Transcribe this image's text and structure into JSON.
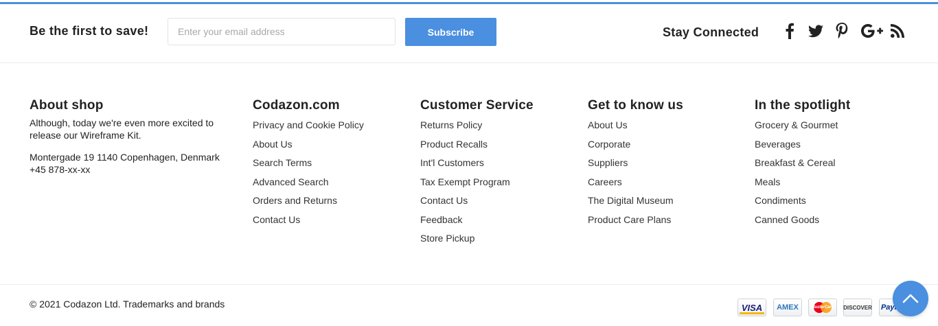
{
  "newsletter": {
    "title": "Be the first to save!",
    "email_placeholder": "Enter your email address",
    "email_value": "",
    "subscribe_label": "Subscribe"
  },
  "social": {
    "title": "Stay Connected",
    "icons": [
      "facebook-icon",
      "twitter-icon",
      "pinterest-icon",
      "google-plus-icon",
      "rss-icon"
    ]
  },
  "about": {
    "title": "About shop",
    "text": "Although, today we're even more excited to release our Wireframe Kit.",
    "address": "Montergade 19 1140 Copenhagen, Denmark",
    "phone": "+45 878-xx-xx"
  },
  "columns": [
    {
      "title": "Codazon.com",
      "links": [
        "Privacy and Cookie Policy",
        "About Us",
        "Search Terms",
        "Advanced Search",
        "Orders and Returns",
        "Contact Us"
      ]
    },
    {
      "title": "Customer Service",
      "links": [
        "Returns Policy",
        "Product Recalls",
        "Int'l Customers",
        "Tax Exempt Program",
        "Contact Us",
        "Feedback",
        "Store Pickup"
      ]
    },
    {
      "title": "Get to know us",
      "links": [
        "About Us",
        "Corporate",
        "Suppliers",
        "Careers",
        "The Digital Museum",
        "Product Care Plans"
      ]
    },
    {
      "title": "In the spotlight",
      "links": [
        "Grocery & Gourmet",
        "Beverages",
        "Breakfast & Cereal",
        "Meals",
        "Condiments",
        "Canned Goods"
      ]
    }
  ],
  "footer": {
    "copyright": "© 2021 Codazon Ltd. Trademarks and brands",
    "payments": {
      "visa": "VISA",
      "amex": "AMEX",
      "mastercard": "MasterCard",
      "discover": "DISCOVER",
      "paypal": "PayPal"
    }
  },
  "colors": {
    "accent": "#4a8fe0",
    "text": "#222222"
  }
}
